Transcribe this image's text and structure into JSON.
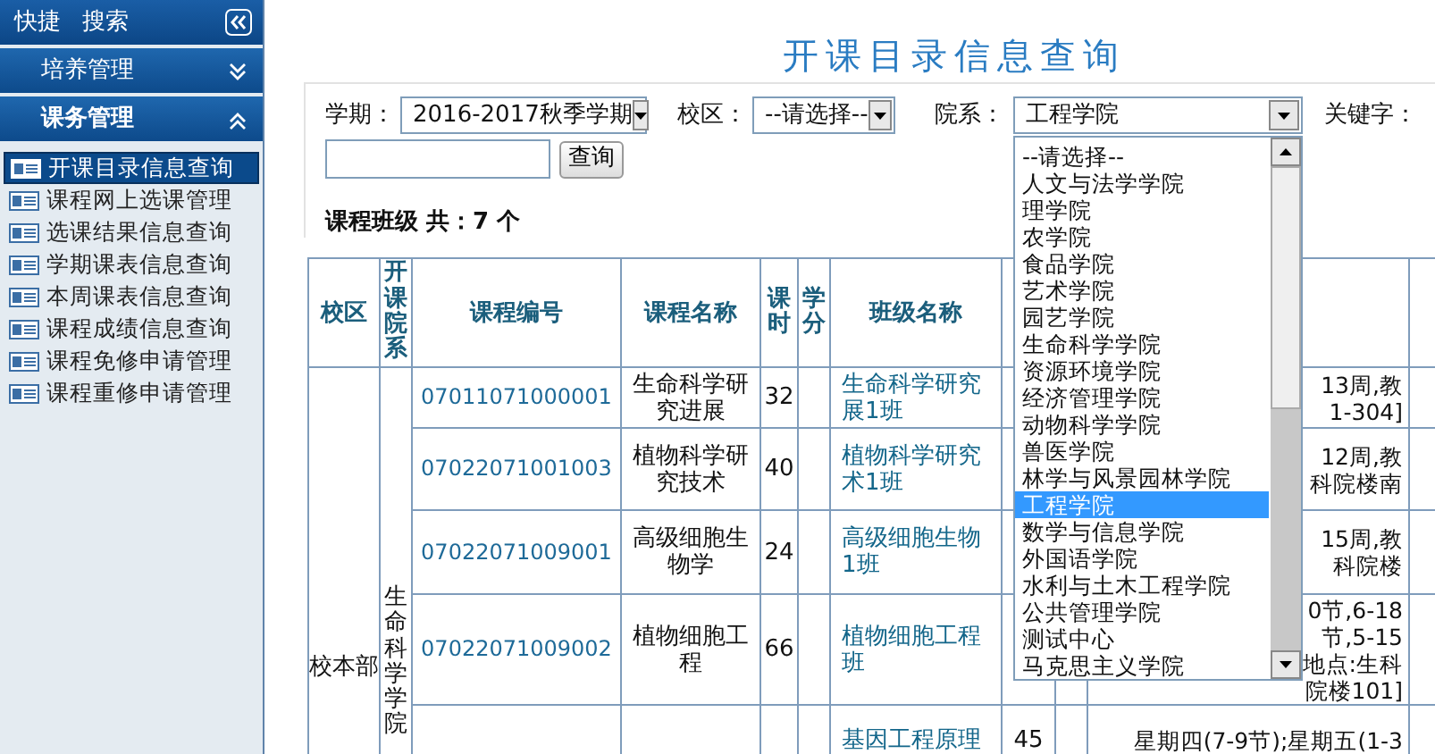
{
  "sidebar": {
    "shortcuts": [
      "快捷",
      "搜索"
    ],
    "groups": [
      {
        "label": "培养管理",
        "expanded": false
      },
      {
        "label": "课务管理",
        "expanded": true,
        "items": [
          {
            "label": "开课目录信息查询",
            "selected": true
          },
          {
            "label": "课程网上选课管理",
            "selected": false
          },
          {
            "label": "选课结果信息查询",
            "selected": false
          },
          {
            "label": "学期课表信息查询",
            "selected": false
          },
          {
            "label": "本周课表信息查询",
            "selected": false
          },
          {
            "label": "课程成绩信息查询",
            "selected": false
          },
          {
            "label": "课程免修申请管理",
            "selected": false
          },
          {
            "label": "课程重修申请管理",
            "selected": false
          }
        ]
      }
    ]
  },
  "title": "开课目录信息查询",
  "filters": {
    "term_label": "学期：",
    "term_value": "2016-2017秋季学期",
    "campus_label": "校区：",
    "campus_value": "--请选择--",
    "college_label": "院系：",
    "college_value": "工程学院",
    "keyword_label": "关键字：",
    "search_button": "查询",
    "college_options": [
      {
        "label": "--请选择--",
        "selected": false
      },
      {
        "label": "人文与法学学院",
        "selected": false
      },
      {
        "label": "理学院",
        "selected": false
      },
      {
        "label": "农学院",
        "selected": false
      },
      {
        "label": "食品学院",
        "selected": false
      },
      {
        "label": "艺术学院",
        "selected": false
      },
      {
        "label": "园艺学院",
        "selected": false
      },
      {
        "label": "生命科学学院",
        "selected": false
      },
      {
        "label": "资源环境学院",
        "selected": false
      },
      {
        "label": "经济管理学院",
        "selected": false
      },
      {
        "label": "动物科学学院",
        "selected": false
      },
      {
        "label": "兽医学院",
        "selected": false
      },
      {
        "label": "林学与风景园林学院",
        "selected": false
      },
      {
        "label": "工程学院",
        "selected": true
      },
      {
        "label": "数学与信息学院",
        "selected": false
      },
      {
        "label": "外国语学院",
        "selected": false
      },
      {
        "label": "水利与土木工程学院",
        "selected": false
      },
      {
        "label": "公共管理学院",
        "selected": false
      },
      {
        "label": "测试中心",
        "selected": false
      },
      {
        "label": "马克思主义学院",
        "selected": false
      }
    ]
  },
  "count_text": "课程班级 共：7 个",
  "table": {
    "columns": [
      "校区",
      "开课院系",
      "课程编号",
      "课程名称",
      "课时",
      "学分",
      "班级名称"
    ],
    "campus": "校本部",
    "college": "生命科学学院",
    "rows": [
      {
        "code": "07011071000001",
        "name": "生命科学研究进展",
        "hours": "32",
        "class_lines": [
          "生命科学研究",
          "展1班"
        ],
        "schedule_lines": [
          "13周,教",
          "1-304]"
        ]
      },
      {
        "code": "07022071001003",
        "name": "植物科学研究技术",
        "hours": "40",
        "class_lines": [
          "植物科学研究",
          "术1班"
        ],
        "schedule_lines": [
          "12周,教",
          "科院楼南"
        ]
      },
      {
        "code": "07022071009001",
        "name": "高级细胞生物学",
        "hours": "24",
        "class_lines": [
          "高级细胞生物",
          "1班"
        ],
        "schedule_lines": [
          "15周,教",
          "科院楼"
        ]
      },
      {
        "code": "07022071009002",
        "name": "植物细胞工程",
        "hours": "66",
        "class_lines": [
          "植物细胞工程",
          "班"
        ],
        "schedule_lines": [
          "0节,6-18",
          "节,5-15",
          "地点:生科",
          "院楼101]"
        ]
      },
      {
        "class_lines": [
          "基因工程原理"
        ],
        "column_8": "45",
        "schedule_lines": [
          "星期四(7-9节);星期五(1-3"
        ]
      }
    ]
  }
}
